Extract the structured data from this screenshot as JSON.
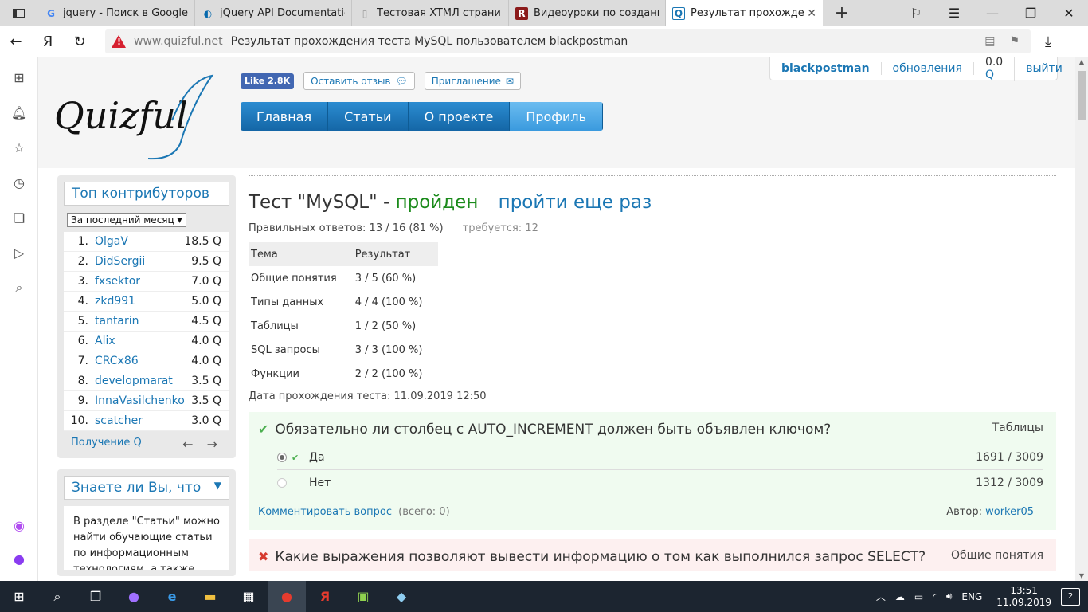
{
  "browser": {
    "tabs": [
      {
        "title": "jquery - Поиск в Google",
        "icon": "google-icon",
        "active": false
      },
      {
        "title": "jQuery API Documentation",
        "icon": "jquery-icon",
        "active": false
      },
      {
        "title": "Тестовая XTMЛ страница",
        "icon": "document-icon",
        "active": false
      },
      {
        "title": "Видеоуроки по созданию",
        "icon": "r-site-icon",
        "active": false
      },
      {
        "title": "Результат прохождения",
        "icon": "quizful-icon",
        "active": true
      }
    ],
    "domain": "www.quizful.net",
    "page_title": "Результат прохождения теста MySQL пользователем blackpostman",
    "yandex_glyph": "Я"
  },
  "header": {
    "logo_text": "Quizful",
    "fb_like": "Like 2.8K",
    "feedback": "Оставить отзыв",
    "invite": "Приглашение",
    "menu": [
      "Главная",
      "Статьи",
      "О проекте",
      "Профиль"
    ],
    "user": {
      "name": "blackpostman",
      "updates": "обновления",
      "balance": "0.0",
      "balance_unit": "Q",
      "logout": "выйти"
    }
  },
  "contributors": {
    "title": "Топ контрибуторов",
    "period": "За последний месяц",
    "rows": [
      {
        "n": "1.",
        "name": "OlgaV",
        "q": "18.5 Q"
      },
      {
        "n": "2.",
        "name": "DidSergii",
        "q": "9.5 Q"
      },
      {
        "n": "3.",
        "name": "fxsektor",
        "q": "7.0 Q"
      },
      {
        "n": "4.",
        "name": "zkd991",
        "q": "5.0 Q"
      },
      {
        "n": "5.",
        "name": "tantarin",
        "q": "4.5 Q"
      },
      {
        "n": "6.",
        "name": "Alix",
        "q": "4.0 Q"
      },
      {
        "n": "7.",
        "name": "CRCx86",
        "q": "4.0 Q"
      },
      {
        "n": "8.",
        "name": "developmarat",
        "q": "3.5 Q"
      },
      {
        "n": "9.",
        "name": "InnaVasilchenko",
        "q": "3.5 Q"
      },
      {
        "n": "10.",
        "name": "scatcher",
        "q": "3.0 Q"
      }
    ],
    "footer_link": "Получение Q",
    "arrows": "← →"
  },
  "didyouknow": {
    "title": "Знаете ли Вы, что",
    "text": "В разделе \"Статьи\" можно найти обучающие статьи по информационным технологиям, а также"
  },
  "result": {
    "title_prefix": "Тест \"MySQL\" -",
    "status": "пройден",
    "again": "пройти еще раз",
    "correct": "Правильных ответов: 13 / 16 (81 %)",
    "required": "требуется: 12",
    "table_headers": [
      "Тема",
      "Результат"
    ],
    "table_rows": [
      [
        "Общие понятия",
        "3 / 5 (60 %)"
      ],
      [
        "Типы данных",
        "4 / 4 (100 %)"
      ],
      [
        "Таблицы",
        "1 / 2 (50 %)"
      ],
      [
        "SQL запросы",
        "3 / 3 (100 %)"
      ],
      [
        "Функции",
        "2 / 2 (100 %)"
      ]
    ],
    "date": "Дата прохождения теста: 11.09.2019 12:50"
  },
  "questions": [
    {
      "text": "Обязательно ли столбец с AUTO_INCREMENT должен быть объявлен ключом?",
      "topic": "Таблицы",
      "correct": true,
      "answers": [
        {
          "text": "Да",
          "count": "1691 / 3009",
          "selected": true
        },
        {
          "text": "Нет",
          "count": "1312 / 3009",
          "selected": false
        }
      ],
      "comment": "Комментировать вопрос",
      "comment_count": "(всего: 0)",
      "author_label": "Автор:",
      "author": "worker05"
    },
    {
      "text": "Какие выражения позволяют вывести информацию о том как выполнился запрос SELECT?",
      "topic": "Общие понятия",
      "correct": false
    }
  ],
  "taskbar": {
    "lang": "ENG",
    "time": "13:51",
    "date": "11.09.2019",
    "notifications": "2"
  }
}
